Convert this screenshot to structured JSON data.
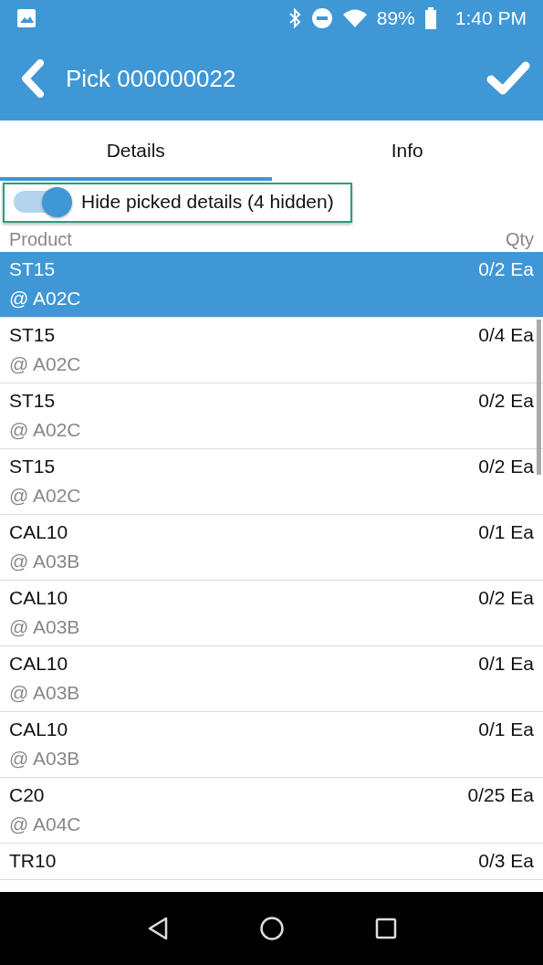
{
  "status_bar": {
    "battery": "89%",
    "time": "1:40 PM"
  },
  "app_bar": {
    "title": "Pick 000000022"
  },
  "tabs": [
    {
      "label": "Details",
      "selected": true
    },
    {
      "label": "Info",
      "selected": false
    }
  ],
  "filter_toggle": {
    "label": "Hide picked details (4 hidden)",
    "on": true
  },
  "columns": [
    "Product",
    "Qty"
  ],
  "rows": [
    {
      "product": "ST15",
      "location": "@ A02C",
      "qty": "0/2 Ea",
      "selected": true
    },
    {
      "product": "ST15",
      "location": "@ A02C",
      "qty": "0/4 Ea",
      "selected": false
    },
    {
      "product": "ST15",
      "location": "@ A02C",
      "qty": "0/2 Ea",
      "selected": false
    },
    {
      "product": "ST15",
      "location": "@ A02C",
      "qty": "0/2 Ea",
      "selected": false
    },
    {
      "product": "CAL10",
      "location": "@ A03B",
      "qty": "0/1 Ea",
      "selected": false
    },
    {
      "product": "CAL10",
      "location": "@ A03B",
      "qty": "0/2 Ea",
      "selected": false
    },
    {
      "product": "CAL10",
      "location": "@ A03B",
      "qty": "0/1 Ea",
      "selected": false
    },
    {
      "product": "CAL10",
      "location": "@ A03B",
      "qty": "0/1 Ea",
      "selected": false
    },
    {
      "product": "C20",
      "location": "@ A04C",
      "qty": "0/25 Ea",
      "selected": false
    },
    {
      "product": "TR10",
      "qty": "0/3 Ea",
      "selected": false
    }
  ]
}
